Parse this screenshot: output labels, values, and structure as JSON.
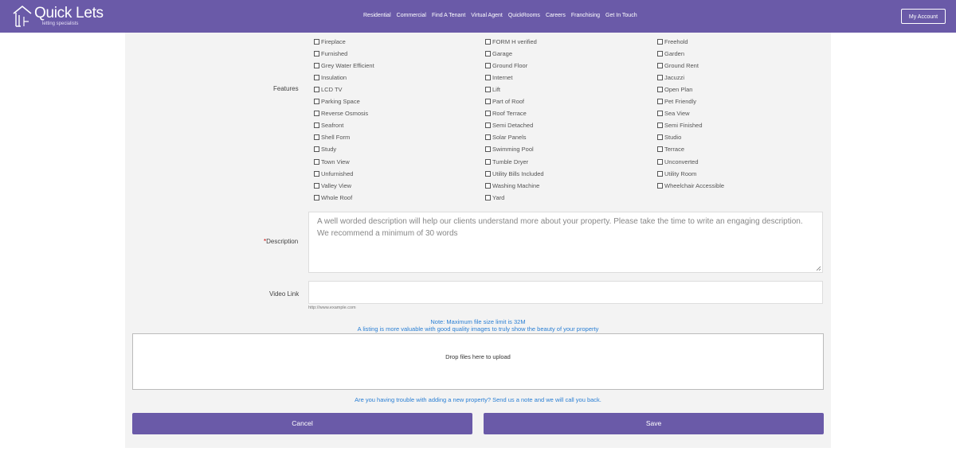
{
  "brand": {
    "title": "Quick Lets",
    "subtitle": "letting specialists"
  },
  "nav": [
    "Residential",
    "Commercial",
    "Find A Tenant",
    "Virtual Agent",
    "QuickRooms",
    "Careers",
    "Franchising",
    "Get In Touch"
  ],
  "account_label": "My Account",
  "features": {
    "label": "Features",
    "columns": [
      [
        "Fireplace",
        "Furnished",
        "Grey Water Efficient",
        "Insulation",
        "LCD TV",
        "Parking Space",
        "Reverse Osmosis",
        "Seafront",
        "Shell Form",
        "Study",
        "Town View",
        "Unfurnished",
        "Valley View",
        "Whole Roof"
      ],
      [
        "FORM H verified",
        "Garage",
        "Ground Floor",
        "Internet",
        "Lift",
        "Part of Roof",
        "Roof Terrace",
        "Semi Detached",
        "Solar Panels",
        "Swimming Pool",
        "Tumble Dryer",
        "Utility Bills Included",
        "Washing Machine",
        "Yard"
      ],
      [
        "Freehold",
        "Garden",
        "Ground Rent",
        "Jacuzzi",
        "Open Plan",
        "Pet Friendly",
        "Sea View",
        "Semi Finished",
        "Studio",
        "Terrace",
        "Unconverted",
        "Utility Room",
        "Wheelchair Accessible"
      ]
    ]
  },
  "description": {
    "required_mark": "*",
    "label": "Description",
    "placeholder": "A well worded description will help our clients understand more about your property. Please take the time to write an engaging description. We recommend a minimum of 30 words"
  },
  "video": {
    "label": "Video Link",
    "hint": "http://www.example.com"
  },
  "upload": {
    "note_size": "Note: Maximum file size limit is 32M",
    "note_quality": "A listing is more valuable with good quality images to truly show the beauty of your property",
    "drop_text": "Drop files here to upload"
  },
  "help_text": "Are you having trouble with adding a new property? Send us a note and we will call you back.",
  "buttons": {
    "cancel": "Cancel",
    "save": "Save"
  },
  "colors": {
    "accent": "#6a5aa8",
    "link": "#2a7fd4"
  }
}
